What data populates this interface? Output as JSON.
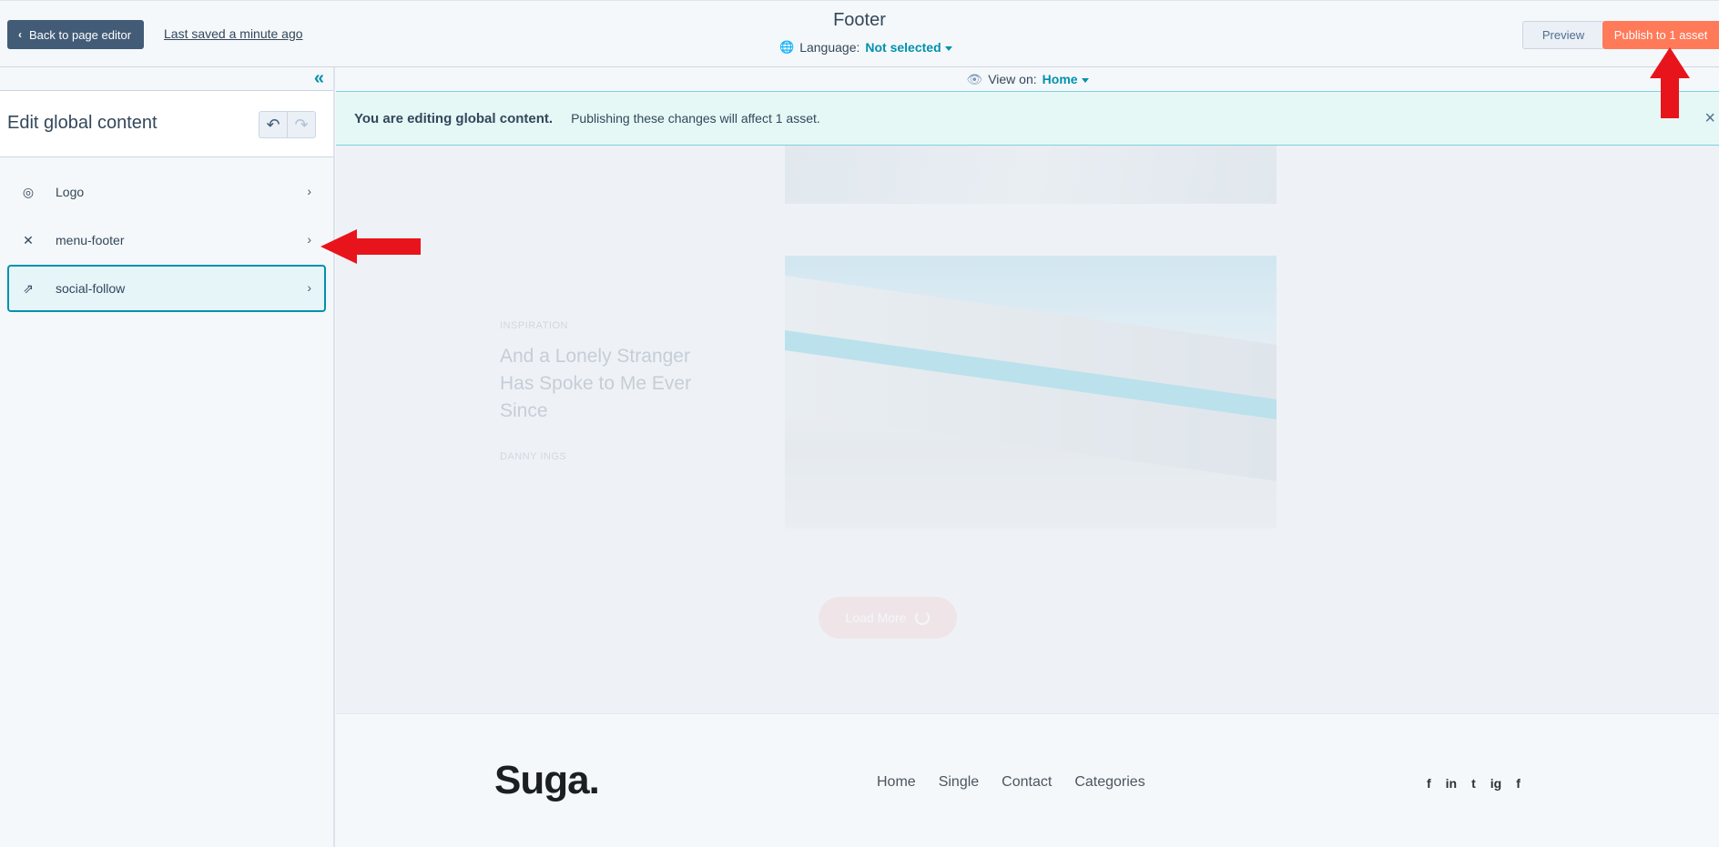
{
  "topbar": {
    "back_label": "Back to page editor",
    "saved_label": "Last saved a minute ago",
    "title": "Footer",
    "language_label": "Language:",
    "language_value": "Not selected",
    "preview_label": "Preview",
    "publish_label": "Publish to 1 asset"
  },
  "sidebar": {
    "title": "Edit global content",
    "items": [
      {
        "label": "Logo",
        "icon": "logo-icon"
      },
      {
        "label": "menu-footer",
        "icon": "menu-icon"
      },
      {
        "label": "social-follow",
        "icon": "share-icon"
      }
    ]
  },
  "canvas": {
    "view_on_label": "View on:",
    "view_on_value": "Home",
    "banner_bold": "You are editing global content.",
    "banner_text": "Publishing these changes will affect 1 asset.",
    "post": {
      "category": "INSPIRATION",
      "title": "And a Lonely Stranger Has Spoke to Me Ever Since",
      "author": "DANNY INGS"
    },
    "load_more": "Load More"
  },
  "footer": {
    "logo": "Suga.",
    "nav": [
      "Home",
      "Single",
      "Contact",
      "Categories"
    ],
    "social": [
      "f",
      "in",
      "t",
      "ig",
      "f"
    ]
  },
  "colors": {
    "primary_dark": "#425b76",
    "accent_teal": "#0091ae",
    "publish_orange": "#ff7a59",
    "annotation_red": "#e8141c"
  }
}
